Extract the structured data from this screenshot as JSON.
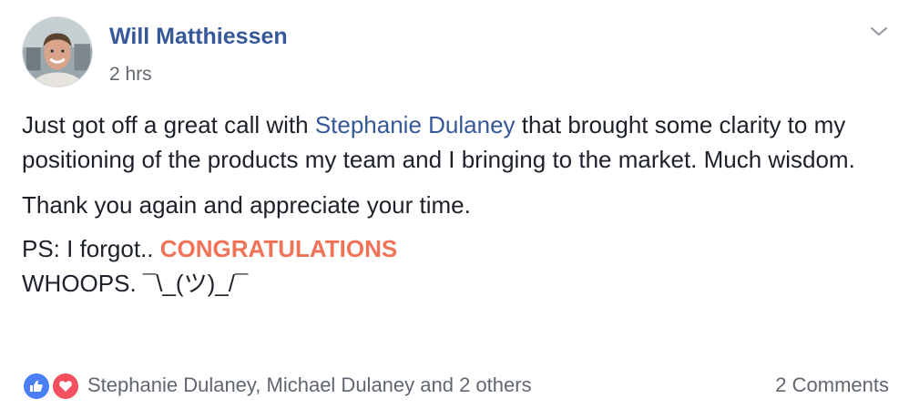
{
  "post": {
    "author": "Will Matthiessen",
    "timestamp": "2 hrs",
    "body": {
      "line1_before_mention": "Just got off a great call with ",
      "mention": "Stephanie Dulaney",
      "line1_after_mention": " that brought some clarity to my positioning of the products my team and I bringing to the market. Much wisdom.",
      "line2": "Thank you again and appreciate your time.",
      "line3_before_highlight": "PS: I forgot.. ",
      "highlight": "CONGRATULATIONS",
      "line4": "WHOOPS. ¯\\_(ツ)_/¯"
    },
    "highlight_color": "#f07358",
    "link_color": "#365899"
  },
  "footer": {
    "reactions": [
      "like-icon",
      "love-icon"
    ],
    "reactors_text": "Stephanie Dulaney, Michael Dulaney and 2 others",
    "comments_text": "2 Comments"
  }
}
